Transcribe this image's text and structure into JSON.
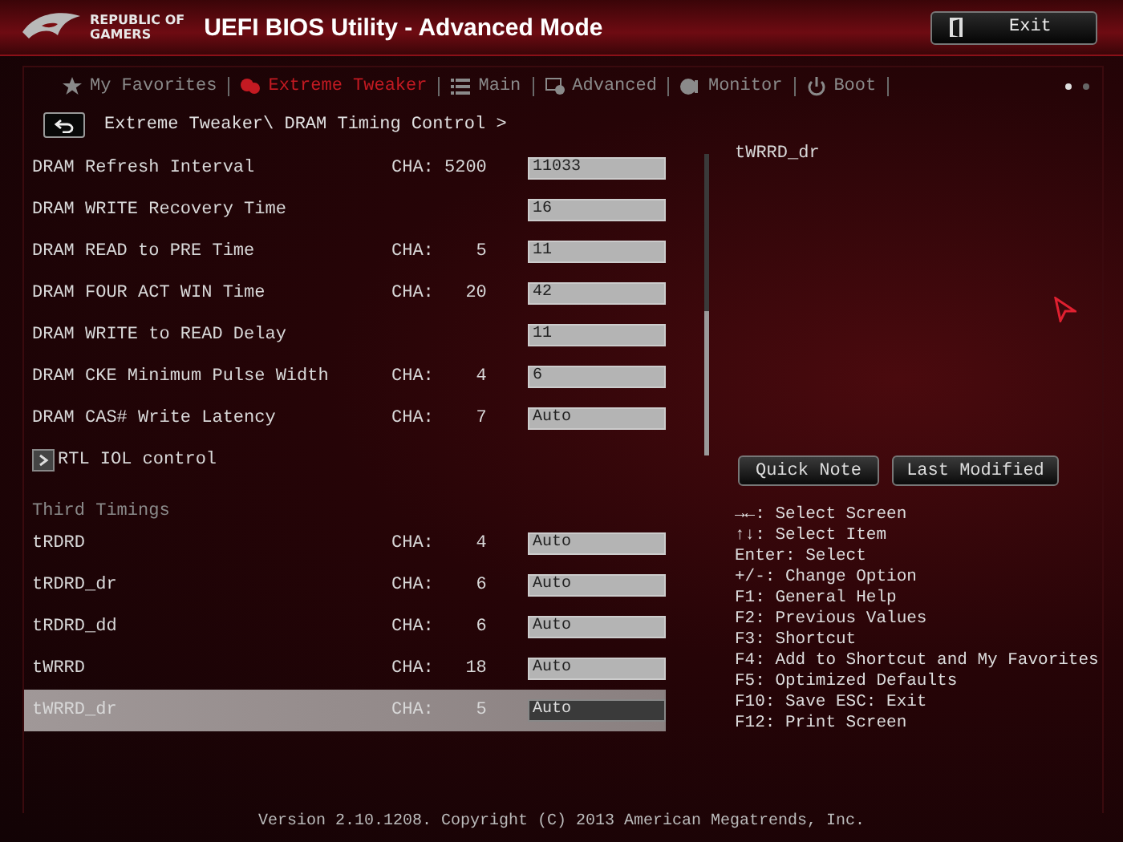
{
  "header": {
    "logo_text": "REPUBLIC OF\nGAMERS",
    "title": "UEFI BIOS Utility - Advanced Mode",
    "exit_button": "Exit"
  },
  "tabs": [
    {
      "label": "My Favorites",
      "selected": false
    },
    {
      "label": "Extreme Tweaker",
      "selected": true
    },
    {
      "label": "Main",
      "selected": false
    },
    {
      "label": "Advanced",
      "selected": false
    },
    {
      "label": "Monitor",
      "selected": false
    },
    {
      "label": "Boot",
      "selected": false
    }
  ],
  "pages": [
    {
      "selected": true
    },
    {
      "selected": false
    }
  ],
  "breadcrumb": "Extreme Tweaker\\ DRAM Timing Control >",
  "settings": [
    {
      "kind": "setting",
      "label": "DRAM Refresh Interval",
      "channel": "CHA: 5200",
      "value": "11033",
      "selected": false
    },
    {
      "kind": "setting",
      "label": "DRAM WRITE Recovery Time",
      "value": "16",
      "selected": false
    },
    {
      "kind": "setting",
      "label": "DRAM READ to PRE Time",
      "channel": "CHA:    5",
      "value": "11",
      "selected": false
    },
    {
      "kind": "setting",
      "label": "DRAM FOUR ACT WIN Time",
      "channel": "CHA:   20",
      "value": "42",
      "selected": false
    },
    {
      "kind": "setting",
      "label": "DRAM WRITE to READ Delay",
      "value": "11",
      "selected": false
    },
    {
      "kind": "setting",
      "label": "DRAM CKE Minimum Pulse Width",
      "channel": "CHA:    4",
      "value": "6",
      "selected": false
    },
    {
      "kind": "setting",
      "label": "DRAM CAS# Write Latency",
      "channel": "CHA:    7",
      "value": "Auto",
      "selected": false
    },
    {
      "kind": "submenu",
      "label": "RTL IOL control",
      "selected": false
    },
    {
      "kind": "heading",
      "label": "Third Timings"
    },
    {
      "kind": "setting",
      "label": "tRDRD",
      "channel": "CHA:    4",
      "value": "Auto",
      "selected": false
    },
    {
      "kind": "setting",
      "label": "tRDRD_dr",
      "channel": "CHA:    6",
      "value": "Auto",
      "selected": false
    },
    {
      "kind": "setting",
      "label": "tRDRD_dd",
      "channel": "CHA:    6",
      "value": "Auto",
      "selected": false
    },
    {
      "kind": "setting",
      "label": "tWRRD",
      "channel": "CHA:   18",
      "value": "Auto",
      "selected": false
    },
    {
      "kind": "setting",
      "label": "tWRRD_dr",
      "channel": "CHA:    5",
      "value": "Auto",
      "selected": true
    }
  ],
  "help_title": "tWRRD_dr",
  "side_buttons": [
    "Quick Note",
    "Last Modified"
  ],
  "key_help": [
    "→←: Select Screen",
    "↑↓: Select Item",
    "Enter: Select",
    "+/-: Change Option",
    "F1: General Help",
    "F2: Previous Values",
    "F3: Shortcut",
    "F4: Add to Shortcut and My Favorites",
    "F5: Optimized Defaults",
    "F10: Save  ESC: Exit",
    "F12: Print Screen"
  ],
  "footer": "Version 2.10.1208. Copyright (C) 2013 American Megatrends, Inc."
}
